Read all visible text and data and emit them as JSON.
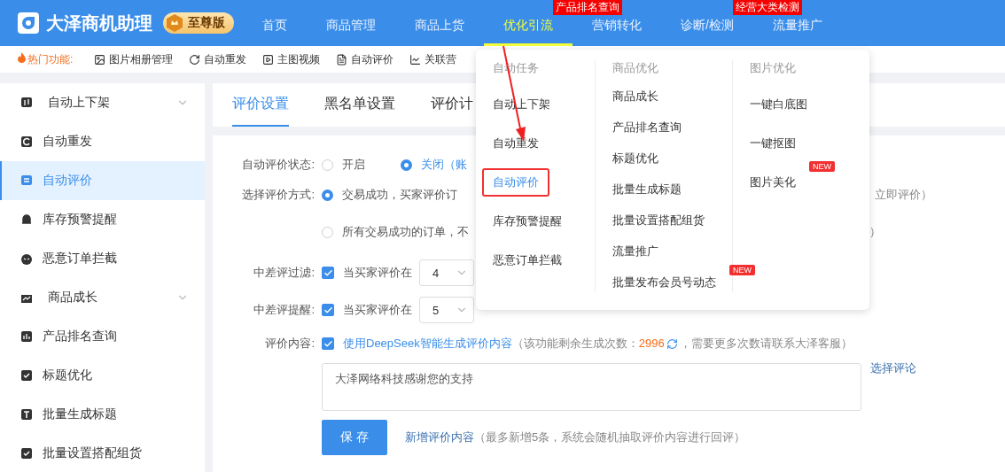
{
  "app": {
    "name": "大泽商机助理",
    "edition": "至尊版"
  },
  "nav": [
    {
      "label": "首页",
      "selected": false
    },
    {
      "label": "商品管理",
      "selected": false
    },
    {
      "label": "商品上货",
      "selected": false
    },
    {
      "label": "优化引流",
      "selected": true,
      "badge": "产品排名查询"
    },
    {
      "label": "营销转化",
      "selected": false
    },
    {
      "label": "诊断/检测",
      "selected": false,
      "badge": "经营大类检测"
    },
    {
      "label": "流量推广",
      "selected": false
    }
  ],
  "hot_bar": {
    "title": "热门功能:",
    "items": [
      "图片相册管理",
      "自动重发",
      "主图视频",
      "自动评价",
      "关联营"
    ]
  },
  "sidebar": [
    {
      "label": "自动上下架",
      "selected": false,
      "expandable": true
    },
    {
      "label": "自动重发",
      "selected": false,
      "expandable": false
    },
    {
      "label": "自动评价",
      "selected": true,
      "expandable": false
    },
    {
      "label": "库存预警提醒",
      "selected": false,
      "expandable": false
    },
    {
      "label": "恶意订单拦截",
      "selected": false,
      "expandable": false
    },
    {
      "label": "商品成长",
      "selected": false,
      "expandable": true
    },
    {
      "label": "产品排名查询",
      "selected": false,
      "expandable": false
    },
    {
      "label": "标题优化",
      "selected": false,
      "expandable": false
    },
    {
      "label": "批量生成标题",
      "selected": false,
      "expandable": false
    },
    {
      "label": "批量设置搭配组货",
      "selected": false,
      "expandable": false
    }
  ],
  "tabs": [
    {
      "label": "评价设置",
      "selected": true
    },
    {
      "label": "黑名单设置",
      "selected": false
    },
    {
      "label": "评价计",
      "selected": false
    }
  ],
  "form": {
    "status": {
      "label": "自动评价状态:",
      "options": [
        {
          "label": "开启",
          "selected": false
        },
        {
          "label": "关闭（账",
          "selected": true
        }
      ]
    },
    "method": {
      "label": "选择评价方式:",
      "options": [
        {
          "label": "交易成功，买家评价订",
          "tail": "立即评价）",
          "selected": true
        },
        {
          "label": "所有交易成功的订单，不",
          "tail": "）",
          "selected": false
        }
      ]
    },
    "filter": {
      "label": "中差评过滤:",
      "checked": true,
      "text": "当买家评价在",
      "select": "4"
    },
    "remind": {
      "label": "中差评提醒:",
      "checked": true,
      "text": "当买家评价在",
      "select": "5"
    },
    "content": {
      "label": "评价内容:",
      "checked": true,
      "link": "使用DeepSeek智能生成评价内容",
      "note_before": "（该功能剩余生成次数：",
      "count": "2996",
      "note_after": "，需要更多次数请联系大泽客服）",
      "textarea": "大泽网络科技感谢您的支持",
      "pick": "选择评论"
    },
    "save": "保 存",
    "add_link": "新增评价内容",
    "add_hint": "（最多新增5条，系统会随机抽取评价内容进行回评）"
  },
  "dropdown": {
    "columns": [
      {
        "heading": "自动任务",
        "items": [
          {
            "label": "自动上下架",
            "selected": false
          },
          {
            "label": "自动重发",
            "selected": false
          },
          {
            "label": "自动评价",
            "selected": true
          },
          {
            "label": "库存预警提醒",
            "selected": false
          },
          {
            "label": "恶意订单拦截",
            "selected": false
          }
        ]
      },
      {
        "heading": "商品优化",
        "items": [
          {
            "label": "商品成长",
            "selected": false
          },
          {
            "label": "产品排名查询",
            "selected": false
          },
          {
            "label": "标题优化",
            "selected": false
          },
          {
            "label": "批量生成标题",
            "selected": false
          },
          {
            "label": "批量设置搭配组货",
            "selected": false
          },
          {
            "label": "流量推广",
            "selected": false
          },
          {
            "label": "批量发布会员号动态",
            "selected": false,
            "badge": "NEW"
          }
        ]
      },
      {
        "heading": "图片优化",
        "items": [
          {
            "label": "一键白底图",
            "selected": false
          },
          {
            "label": "一键抠图",
            "selected": false
          },
          {
            "label": "图片美化",
            "selected": false,
            "badge": "NEW"
          }
        ]
      }
    ]
  }
}
